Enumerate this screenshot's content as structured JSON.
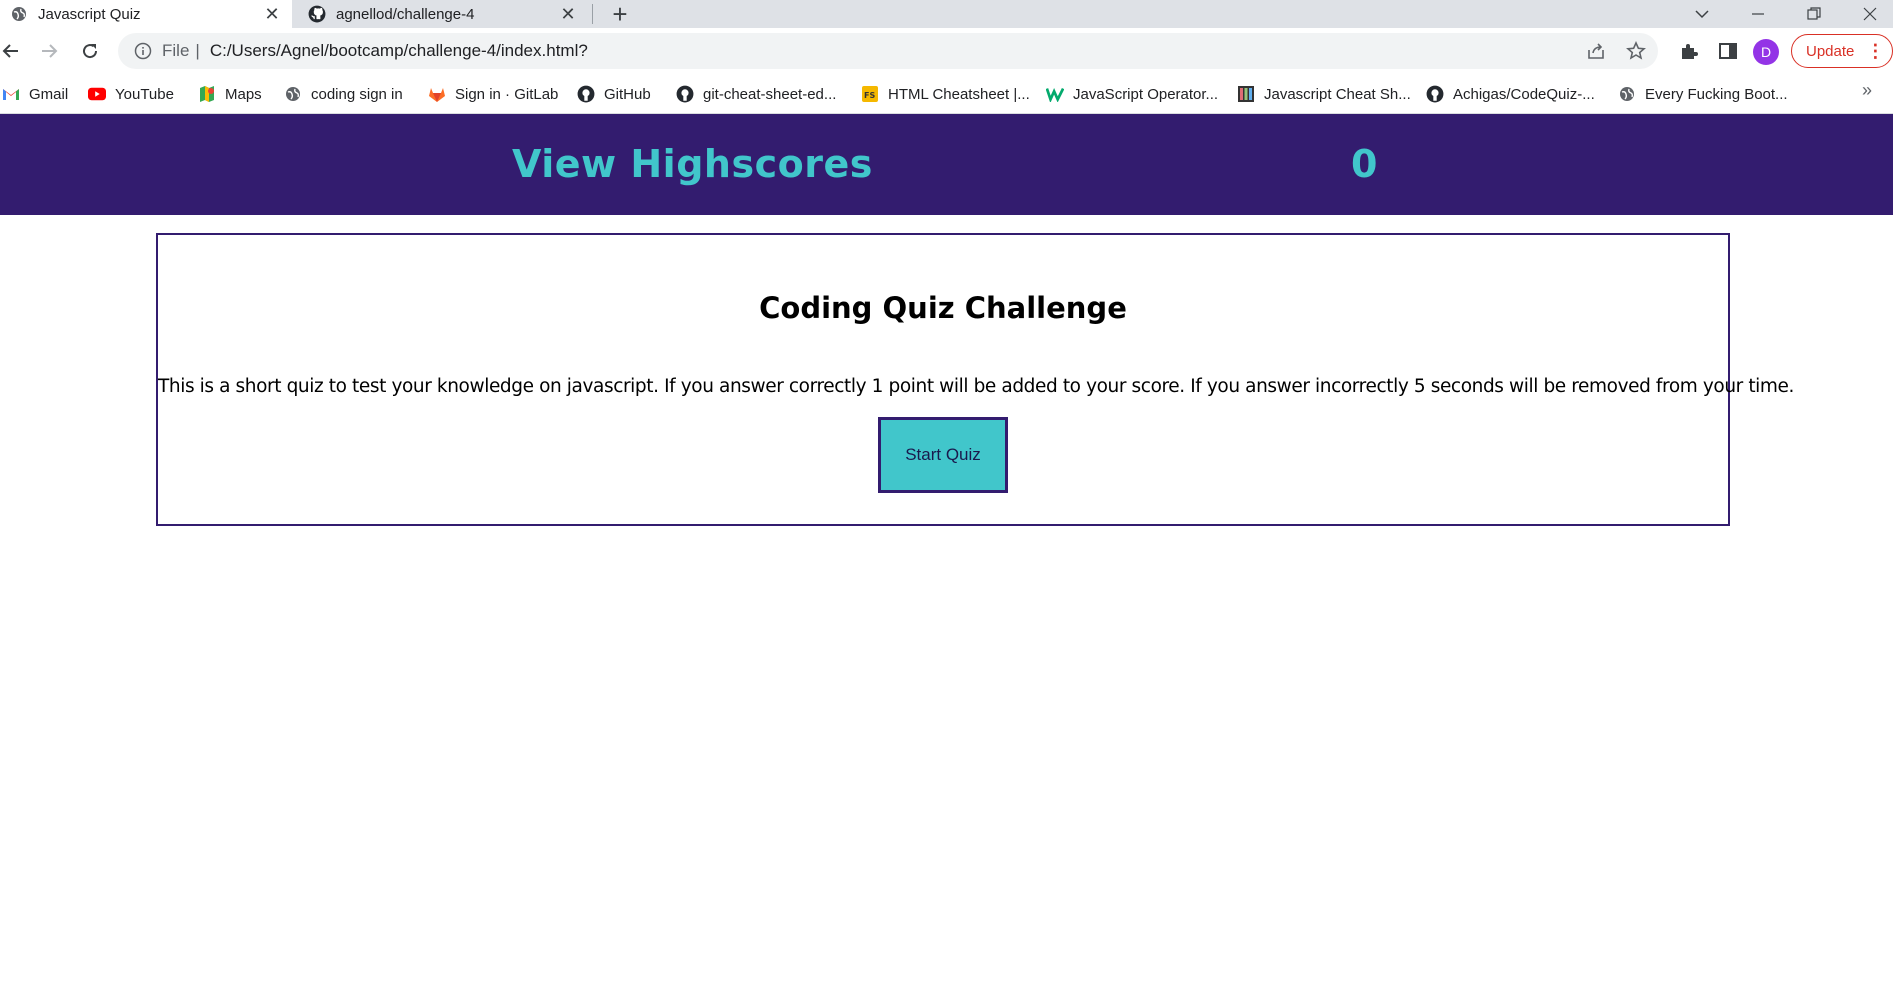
{
  "browser": {
    "tabs": [
      {
        "title": "Javascript Quiz",
        "icon": "globe-icon",
        "active": true
      },
      {
        "title": "agnellod/challenge-4",
        "icon": "github-icon",
        "active": false
      }
    ],
    "address": {
      "scheme_label": "File",
      "url": "C:/Users/Agnel/bootcamp/challenge-4/index.html?"
    },
    "update_label": "Update",
    "profile_initial": "D",
    "bookmarks": [
      {
        "label": "Gmail",
        "icon": "gmail-icon"
      },
      {
        "label": "YouTube",
        "icon": "youtube-icon"
      },
      {
        "label": "Maps",
        "icon": "maps-icon"
      },
      {
        "label": "coding sign in",
        "icon": "globe-icon"
      },
      {
        "label": "Sign in · GitLab",
        "icon": "gitlab-icon"
      },
      {
        "label": "GitHub",
        "icon": "github-icon"
      },
      {
        "label": "git-cheat-sheet-ed...",
        "icon": "github-icon"
      },
      {
        "label": "HTML Cheatsheet |...",
        "icon": "fs-icon"
      },
      {
        "label": "JavaScript Operator...",
        "icon": "w-icon"
      },
      {
        "label": "Javascript Cheat Sh...",
        "icon": "sheet-icon"
      },
      {
        "label": "Achigas/CodeQuiz-...",
        "icon": "github-icon"
      },
      {
        "label": "Every Fucking Boot...",
        "icon": "globe-icon"
      }
    ],
    "bookmarks_more": "»"
  },
  "page": {
    "header": {
      "highscores_label": "View Highscores",
      "timer_value": "0"
    },
    "quiz": {
      "title": "Coding Quiz Challenge",
      "description": "This is a short quiz to test your knowledge on javascript. If you answer correctly 1 point will be added to your score. If you answer incorrectly 5 seconds will be removed from your time.",
      "start_label": "Start Quiz"
    }
  },
  "colors": {
    "header_bg": "#331c6f",
    "accent": "#41c6cb"
  }
}
